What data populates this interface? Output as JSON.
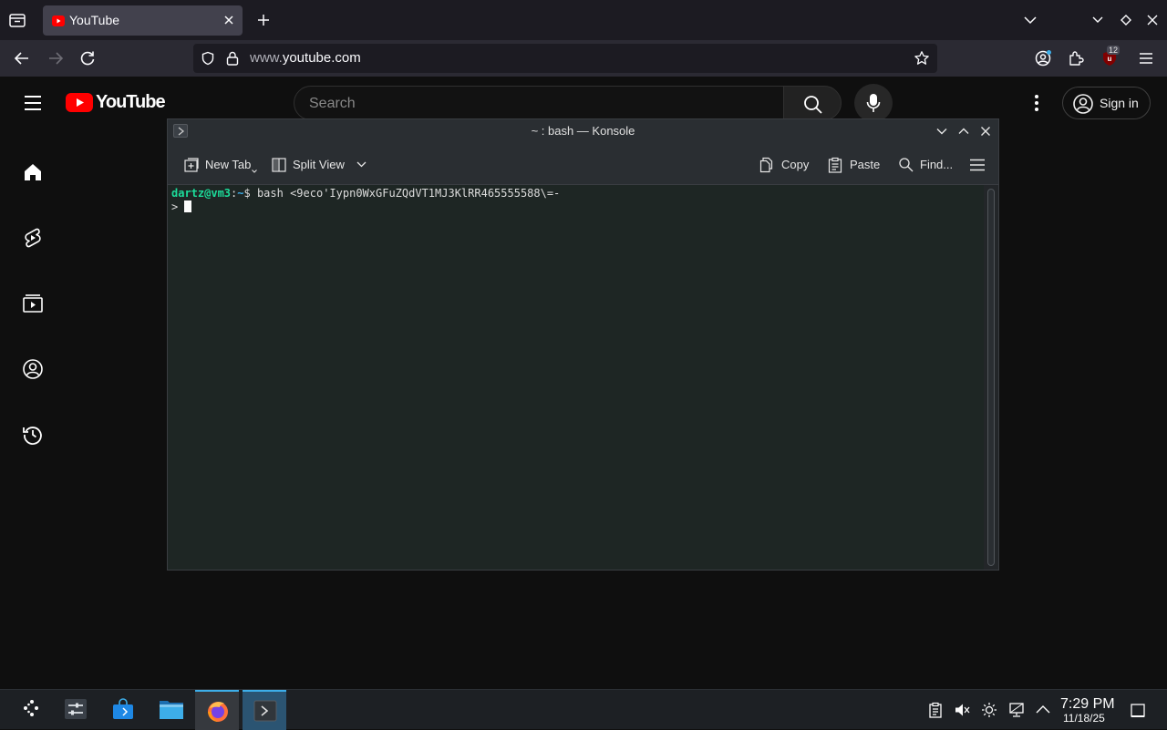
{
  "browser": {
    "tab": {
      "title": "YouTube"
    },
    "address": {
      "host_prefix": "www.",
      "host": "youtube.com"
    },
    "ublock_count": "12"
  },
  "youtube": {
    "logo_text": "YouTube",
    "search_placeholder": "Search",
    "sign_in_label": "Sign in",
    "sidebar": [
      "home-icon",
      "shorts-icon",
      "subscriptions-icon",
      "you-icon",
      "history-icon"
    ]
  },
  "konsole": {
    "title": "~ : bash — Konsole",
    "toolbar": {
      "new_tab": "New Tab",
      "split_view": "Split View",
      "copy": "Copy",
      "paste": "Paste",
      "find": "Find..."
    },
    "terminal": {
      "user_host": "dartz@vm3",
      "sep": ":",
      "path": "~",
      "prompt_end": "$ ",
      "command": "bash <9eco'Iypn0WxGFuZQdVT1MJ3KlRR465555588\\=-",
      "continuation": "> "
    }
  },
  "taskbar": {
    "time": "7:29 PM",
    "date": "11/18/25",
    "apps": [
      "application-launcher",
      "system-settings",
      "discover-store",
      "dolphin-files",
      "firefox",
      "konsole"
    ]
  },
  "colors": {
    "youtube_red": "#ff0000",
    "terminal_user": "#1cdc9a",
    "terminal_path": "#3daee9",
    "accent": "#3daee9"
  }
}
